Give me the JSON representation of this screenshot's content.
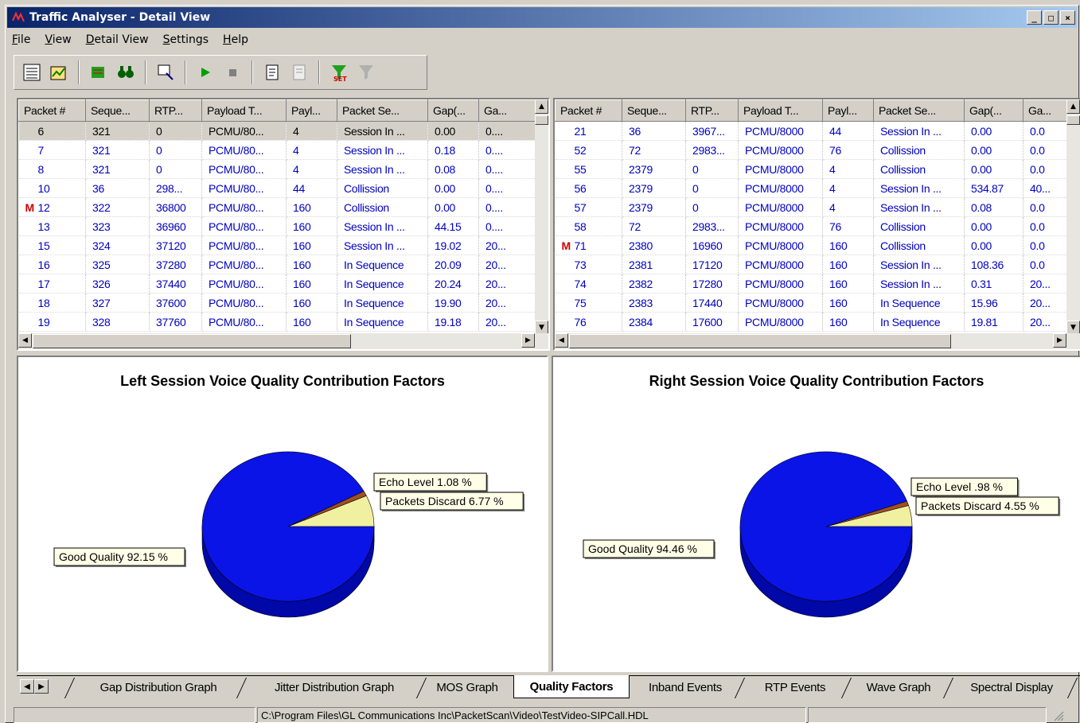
{
  "window": {
    "title": "Traffic Analyser - Detail View",
    "btn_min": "_",
    "btn_max": "□",
    "btn_close": "×"
  },
  "menu": [
    "File",
    "View",
    "Detail View",
    "Settings",
    "Help"
  ],
  "toolbar": [
    "list-view-icon",
    "chart-view-icon",
    "green-capture-icon",
    "binoculars-icon",
    "export-icon",
    "play-icon",
    "stop-icon",
    "report-icon",
    "report-disabled-icon",
    "set-filter-icon",
    "clear-filter-icon"
  ],
  "left_table": {
    "columns": [
      "Packet #",
      "Seque...",
      "RTP...",
      "Payload T...",
      "Payl...",
      "Packet Se...",
      "Gap(...",
      "Ga..."
    ],
    "rows": [
      {
        "marker": "",
        "cells": [
          "6",
          "321",
          "0",
          "PCMU/80...",
          "4",
          "Session In ...",
          "0.00",
          "0...."
        ],
        "selected": true
      },
      {
        "marker": "",
        "cells": [
          "7",
          "321",
          "0",
          "PCMU/80...",
          "4",
          "Session In ...",
          "0.18",
          "0...."
        ]
      },
      {
        "marker": "",
        "cells": [
          "8",
          "321",
          "0",
          "PCMU/80...",
          "4",
          "Session In ...",
          "0.08",
          "0...."
        ]
      },
      {
        "marker": "",
        "cells": [
          "10",
          "36",
          "298...",
          "PCMU/80...",
          "44",
          "Collission",
          "0.00",
          "0...."
        ]
      },
      {
        "marker": "M",
        "cells": [
          "12",
          "322",
          "36800",
          "PCMU/80...",
          "160",
          "Collission",
          "0.00",
          "0...."
        ]
      },
      {
        "marker": "",
        "cells": [
          "13",
          "323",
          "36960",
          "PCMU/80...",
          "160",
          "Session In ...",
          "44.15",
          "0...."
        ]
      },
      {
        "marker": "",
        "cells": [
          "15",
          "324",
          "37120",
          "PCMU/80...",
          "160",
          "Session In ...",
          "19.02",
          "20..."
        ]
      },
      {
        "marker": "",
        "cells": [
          "16",
          "325",
          "37280",
          "PCMU/80...",
          "160",
          "In Sequence",
          "20.09",
          "20..."
        ]
      },
      {
        "marker": "",
        "cells": [
          "17",
          "326",
          "37440",
          "PCMU/80...",
          "160",
          "In Sequence",
          "20.24",
          "20..."
        ]
      },
      {
        "marker": "",
        "cells": [
          "18",
          "327",
          "37600",
          "PCMU/80...",
          "160",
          "In Sequence",
          "19.90",
          "20..."
        ]
      },
      {
        "marker": "",
        "cells": [
          "19",
          "328",
          "37760",
          "PCMU/80...",
          "160",
          "In Sequence",
          "19.18",
          "20..."
        ]
      }
    ]
  },
  "right_table": {
    "columns": [
      "Packet #",
      "Seque...",
      "RTP...",
      "Payload T...",
      "Payl...",
      "Packet Se...",
      "Gap(...",
      "Ga..."
    ],
    "rows": [
      {
        "marker": "",
        "cells": [
          "21",
          "36",
          "3967...",
          "PCMU/8000",
          "44",
          "Session In ...",
          "0.00",
          "0.0"
        ]
      },
      {
        "marker": "",
        "cells": [
          "52",
          "72",
          "2983...",
          "PCMU/8000",
          "76",
          "Collission",
          "0.00",
          "0.0"
        ]
      },
      {
        "marker": "",
        "cells": [
          "55",
          "2379",
          "0",
          "PCMU/8000",
          "4",
          "Collission",
          "0.00",
          "0.0"
        ]
      },
      {
        "marker": "",
        "cells": [
          "56",
          "2379",
          "0",
          "PCMU/8000",
          "4",
          "Session In ...",
          "534.87",
          "40..."
        ]
      },
      {
        "marker": "",
        "cells": [
          "57",
          "2379",
          "0",
          "PCMU/8000",
          "4",
          "Session In ...",
          "0.08",
          "0.0"
        ]
      },
      {
        "marker": "",
        "cells": [
          "58",
          "72",
          "2983...",
          "PCMU/8000",
          "76",
          "Collission",
          "0.00",
          "0.0"
        ]
      },
      {
        "marker": "M",
        "cells": [
          "71",
          "2380",
          "16960",
          "PCMU/8000",
          "160",
          "Collission",
          "0.00",
          "0.0"
        ]
      },
      {
        "marker": "",
        "cells": [
          "73",
          "2381",
          "17120",
          "PCMU/8000",
          "160",
          "Session In ...",
          "108.36",
          "0.0"
        ]
      },
      {
        "marker": "",
        "cells": [
          "74",
          "2382",
          "17280",
          "PCMU/8000",
          "160",
          "Session In ...",
          "0.31",
          "20..."
        ]
      },
      {
        "marker": "",
        "cells": [
          "75",
          "2383",
          "17440",
          "PCMU/8000",
          "160",
          "In Sequence",
          "15.96",
          "20..."
        ]
      },
      {
        "marker": "",
        "cells": [
          "76",
          "2384",
          "17600",
          "PCMU/8000",
          "160",
          "In Sequence",
          "19.81",
          "20..."
        ]
      }
    ]
  },
  "chart_data": [
    {
      "type": "pie",
      "title": "Left Session Voice Quality Contribution Factors",
      "slices": [
        {
          "label": "Good Quality 92.15 %",
          "value": 92.15,
          "color": "#0a14e6"
        },
        {
          "label": "Packets Discard 6.77 %",
          "value": 6.77,
          "color": "#f0f0a0"
        },
        {
          "label": "Echo Level 1.08 %",
          "value": 1.08,
          "color": "#a05020"
        }
      ]
    },
    {
      "type": "pie",
      "title": "Right Session Voice Quality Contribution Factors",
      "slices": [
        {
          "label": "Good Quality 94.46 %",
          "value": 94.46,
          "color": "#0a14e6"
        },
        {
          "label": "Packets Discard 4.55 %",
          "value": 4.55,
          "color": "#f0f0a0"
        },
        {
          "label": "Echo Level .98 %",
          "value": 0.98,
          "color": "#a05020"
        }
      ]
    }
  ],
  "tabs": [
    "Gap Distribution Graph",
    "Jitter Distribution Graph",
    "MOS Graph",
    "Quality Factors",
    "Inband Events",
    "RTP Events",
    "Wave Graph",
    "Spectral Display"
  ],
  "active_tab": "Quality Factors",
  "status": {
    "path": "C:\\Program Files\\GL Communications Inc\\PacketScan\\Video\\TestVideo-SIPCall.HDL"
  }
}
